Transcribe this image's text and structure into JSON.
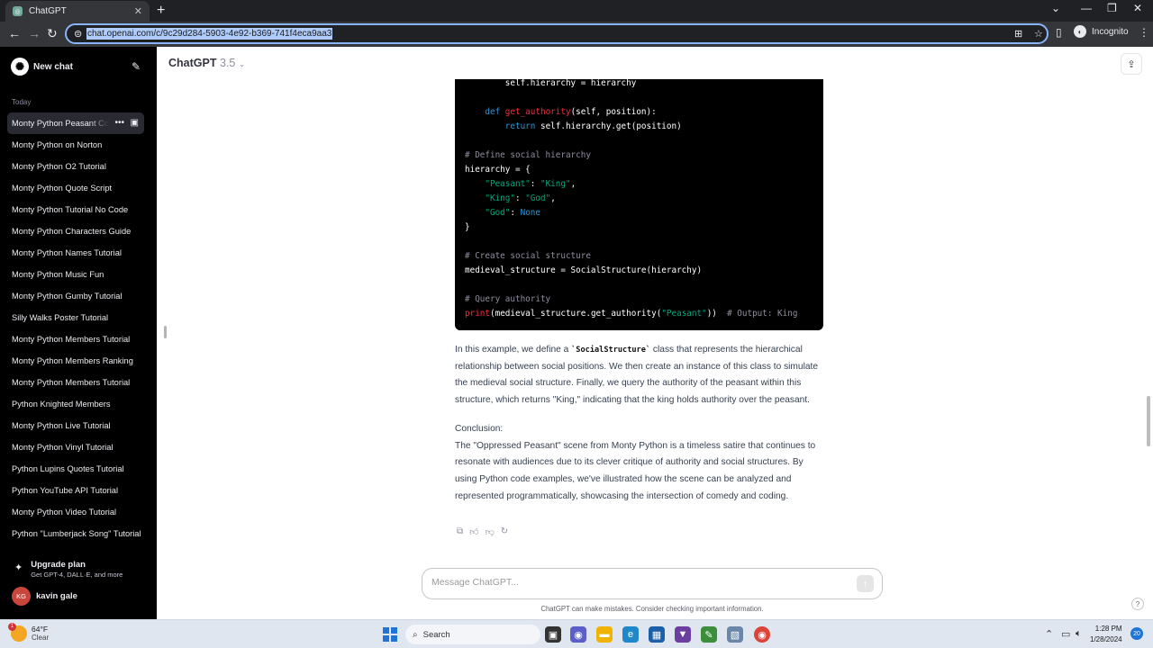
{
  "browser": {
    "tab_title": "ChatGPT",
    "tab_close": "✕",
    "new_tab": "+",
    "url": "chat.openai.com/c/9c29d284-5903-4e92-b369-741f4eca9aa3",
    "profile_label": "Incognito"
  },
  "sidebar": {
    "new_chat_label": "New chat",
    "section_today": "Today",
    "items": [
      "Monty Python Peasant Code",
      "Monty Python on Norton",
      "Monty Python O2 Tutorial",
      "Monty Python Quote Script",
      "Monty Python Tutorial No Code",
      "Monty Python Characters Guide",
      "Monty Python Names Tutorial",
      "Monty Python Music Fun",
      "Monty Python Gumby Tutorial",
      "Silly Walks Poster Tutorial",
      "Monty Python Members Tutorial",
      "Monty Python Members Ranking",
      "Monty Python Members Tutorial",
      "Python Knighted Members",
      "Monty Python Live Tutorial",
      "Monty Python Vinyl Tutorial",
      "Python Lupins Quotes Tutorial",
      "Python YouTube API Tutorial",
      "Monty Python Video Tutorial",
      "Python \"Lumberjack Song\" Tutorial"
    ],
    "upgrade_title": "Upgrade plan",
    "upgrade_subtitle": "Get GPT-4, DALL·E, and more",
    "user_initials": "KG",
    "user_name": "kavin gale"
  },
  "header": {
    "model_name": "ChatGPT",
    "model_version": "3.5"
  },
  "code_lines": [
    "        self.hierarchy = hierarchy",
    "",
    "    def get_authority(self, position):",
    "        return self.hierarchy.get(position)",
    "",
    "# Define social hierarchy",
    "hierarchy = {",
    "    \"Peasant\": \"King\",",
    "    \"King\": \"God\",",
    "    \"God\": None",
    "}",
    "",
    "# Create social structure",
    "medieval_structure = SocialStructure(hierarchy)",
    "",
    "# Query authority",
    "print(medieval_structure.get_authority(\"Peasant\"))  # Output: King"
  ],
  "answer": {
    "para1_before": "In this example, we define a ",
    "para1_code": "`SocialStructure`",
    "para1_after": " class that represents the hierarchical relationship between social positions. We then create an instance of this class to simulate the medieval social structure. Finally, we query the authority of the peasant within this structure, which returns \"King,\" indicating that the king holds authority over the peasant.",
    "conclusion_label": "Conclusion:",
    "conclusion_text": "The \"Oppressed Peasant\" scene from Monty Python is a timeless satire that continues to resonate with audiences due to its clever critique of authority and social structures. By using Python code examples, we've illustrated how the scene can be analyzed and represented programmatically, showcasing the intersection of comedy and coding."
  },
  "composer": {
    "placeholder": "Message ChatGPT...",
    "disclaimer": "ChatGPT can make mistakes. Consider checking important information.",
    "help": "?"
  },
  "taskbar": {
    "temperature": "64°F",
    "weather": "Clear",
    "weather_badge": "1",
    "search_label": "Search",
    "time": "1:28 PM",
    "date": "1/28/2024",
    "notifications": "20"
  },
  "colors": {
    "sidebar_bg": "#000000",
    "code_bg": "#000000",
    "keyword": "#2e95d3",
    "function": "#f22c3d",
    "string": "#00a67d",
    "comment": "#8e8ea0"
  }
}
